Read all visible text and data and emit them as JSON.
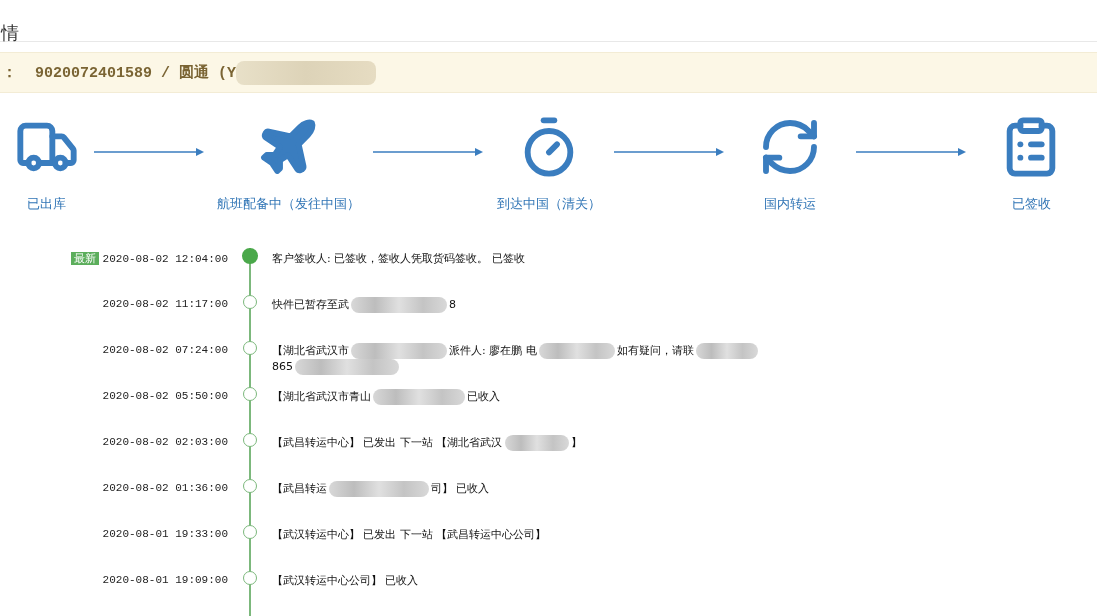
{
  "title": "情",
  "tracking": {
    "parts": [
      {
        "kind": "text",
        "text": "：  9020072401589 / 圆通 (Y"
      },
      {
        "kind": "redacted"
      }
    ]
  },
  "steps": [
    {
      "kind": "truck",
      "label": "已出库"
    },
    {
      "kind": "plane",
      "label": "航班配备中（发往中国）"
    },
    {
      "kind": "arrival",
      "label": "到达中国（清关）"
    },
    {
      "kind": "transit",
      "label": "国内转运"
    },
    {
      "kind": "signed",
      "label": "已签收"
    }
  ],
  "events": [
    {
      "badge": "最新",
      "latest": true,
      "time": "2020-08-02 12:04:00",
      "lines": [
        [
          {
            "kind": "text",
            "text": "客户签收人: 已签收，签收人凭取货码签收。 已签收"
          }
        ]
      ]
    },
    {
      "latest": false,
      "time": "2020-08-02 11:17:00",
      "lines": [
        [
          {
            "kind": "text",
            "text": "快件已暂存至武"
          },
          {
            "kind": "redacted"
          },
          {
            "kind": "text",
            "text": "8"
          }
        ]
      ]
    },
    {
      "latest": false,
      "time": "2020-08-02 07:24:00",
      "lines": [
        [
          {
            "kind": "text",
            "text": "【湖北省武汉市"
          },
          {
            "kind": "redacted"
          },
          {
            "kind": "text",
            "text": "派件人: 廖在鹏 电"
          },
          {
            "kind": "redacted"
          },
          {
            "kind": "text",
            "text": "如有疑问，请联"
          },
          {
            "kind": "redacted"
          }
        ],
        [
          {
            "kind": "text",
            "text": "865"
          },
          {
            "kind": "redacted"
          }
        ]
      ]
    },
    {
      "latest": false,
      "time": "2020-08-02 05:50:00",
      "lines": [
        [
          {
            "kind": "text",
            "text": "【湖北省武汉市青山"
          },
          {
            "kind": "redacted"
          },
          {
            "kind": "text",
            "text": "已收入"
          }
        ]
      ]
    },
    {
      "latest": false,
      "time": "2020-08-02 02:03:00",
      "lines": [
        [
          {
            "kind": "text",
            "text": "【武昌转运中心】 已发出 下一站 【湖北省武汉"
          },
          {
            "kind": "redacted"
          },
          {
            "kind": "text",
            "text": "】"
          }
        ]
      ]
    },
    {
      "latest": false,
      "time": "2020-08-02 01:36:00",
      "lines": [
        [
          {
            "kind": "text",
            "text": "【武昌转运"
          },
          {
            "kind": "redacted"
          },
          {
            "kind": "text",
            "text": "司】 已收入"
          }
        ]
      ]
    },
    {
      "latest": false,
      "time": "2020-08-01 19:33:00",
      "lines": [
        [
          {
            "kind": "text",
            "text": "【武汉转运中心】 已发出 下一站 【武昌转运中心公司】"
          }
        ]
      ]
    },
    {
      "latest": false,
      "time": "2020-08-01 19:09:00",
      "lines": [
        [
          {
            "kind": "text",
            "text": "【武汉转运中心公司】 已收入"
          }
        ]
      ]
    }
  ]
}
